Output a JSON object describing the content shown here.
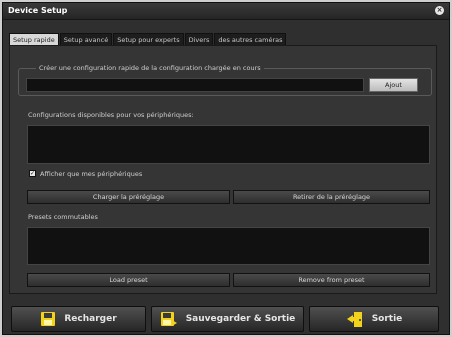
{
  "window": {
    "title": "Device Setup"
  },
  "tabs": [
    {
      "label": "Setup rapide"
    },
    {
      "label": "Setup avancé"
    },
    {
      "label": "Setup pour experts"
    },
    {
      "label": "Divers"
    },
    {
      "label": "des autres caméras"
    }
  ],
  "quick_config": {
    "legend": "Créer une configuration rapide de la configuration chargée en cours",
    "name_value": "",
    "add_label": "Ajout"
  },
  "configs": {
    "label": "Configurations disponibles pour vos périphériques:",
    "show_only_mine_label": "Afficher que mes périphériques",
    "show_only_mine_checked": true,
    "load_preset_label": "Charger la préréglage",
    "remove_preset_label": "Retirer de la préréglage"
  },
  "presets": {
    "label": "Presets commutables",
    "load_label": "Load preset",
    "remove_label": "Remove from preset"
  },
  "footer": {
    "reload_label": "Recharger",
    "save_exit_label": "Sauvegarder & Sortie",
    "exit_label": "Sortie"
  },
  "icons": {
    "reload": "floppy-icon",
    "save_exit": "floppy-exit-icon",
    "exit": "door-exit-icon"
  },
  "colors": {
    "icon_yellow": "#f2d21b",
    "panel": "#353535",
    "dark_field": "#111111"
  }
}
